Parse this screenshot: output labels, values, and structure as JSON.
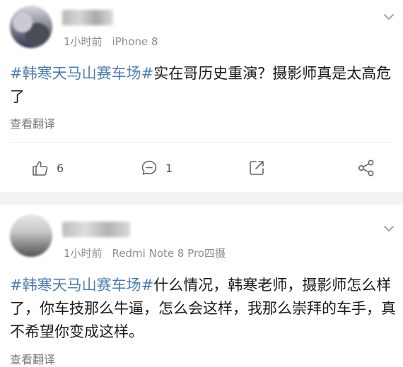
{
  "posts": [
    {
      "time": "1小时前",
      "source": "iPhone 8",
      "hashtag": "#韩寒天马山赛车场#",
      "body": "实在哥历史重演？摄影师真是太高危了",
      "translate_label": "查看翻译",
      "actions": {
        "likes": "6",
        "comments": "1"
      }
    },
    {
      "time": "1小时前",
      "source": "Redmi Note 8 Pro四摄",
      "hashtag": "#韩寒天马山赛车场#",
      "body": "什么情况，韩寒老师，摄影师怎么样了，你车技那么牛逼，怎么会这样，我那么崇拜的车手，真不希望你变成这样。",
      "translate_label": "查看翻译"
    }
  ],
  "icons": {
    "like": "thumbs-up-icon",
    "comment": "comment-bubble-icon",
    "share": "share-arrow-icon",
    "more": "share-nodes-icon",
    "menu": "chevron-down-icon"
  },
  "colors": {
    "hashtag": "#507daf",
    "meta": "#8e8e8e",
    "separator": "#f2f2f2"
  }
}
